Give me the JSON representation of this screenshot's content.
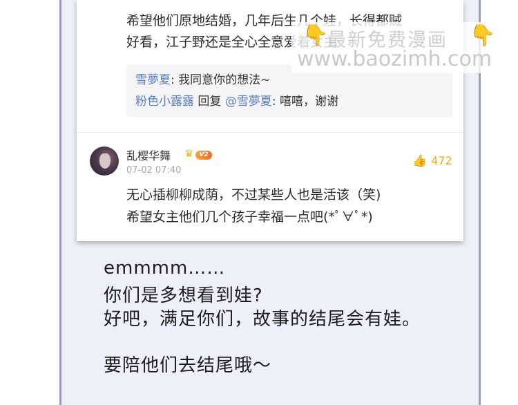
{
  "comment_top": {
    "line1": "希望他们原地结婚，几年后生几个娃，长得都贼",
    "line2": "好看，江子野还是全心全意爱着女主",
    "replies": [
      {
        "user": "雪夢夏",
        "sep": ": ",
        "text": "我同意你的想法~"
      },
      {
        "user": "粉色小露露",
        "action": " 回复 ",
        "mention": "@雪夢夏",
        "sep": ": ",
        "text": "嘻嘻，谢谢"
      }
    ]
  },
  "comment_main": {
    "username": "乱樱华舞",
    "level": "V2",
    "date": "07-02 07:40",
    "likes": "472",
    "line1": "无心插柳柳成荫，不过某些人也是活该（笑)",
    "line2": "希望女主他们几个孩子幸福一点吧(*ﾟ∀ﾟ*)"
  },
  "narration": {
    "line1": "emmmm……",
    "line2": "你们是多想看到娃?",
    "line3": "好吧，满足你们，故事的结尾会有娃。",
    "line4": "要陪他们去结尾哦～"
  },
  "watermark": {
    "title": "最新免费漫画",
    "url": "www.baozimh.com"
  },
  "colors": {
    "frame_border": "#9a98c9",
    "frame_bg": "#eef0f9",
    "username_link": "#5b7fbf",
    "like_accent": "#f2a81d"
  }
}
